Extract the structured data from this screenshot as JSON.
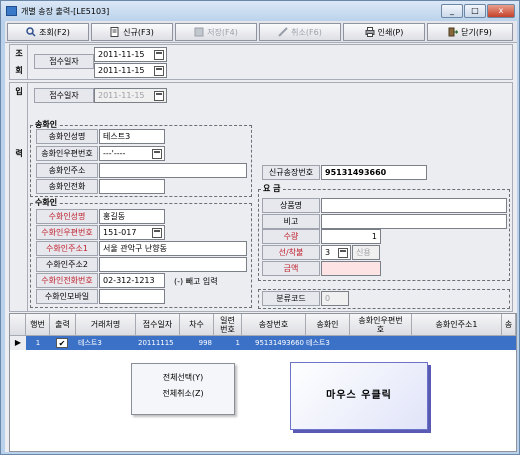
{
  "window": {
    "title": "개별 송장 출력-[LE5103]",
    "min": "_",
    "max": "□",
    "close": "x"
  },
  "toolbar": {
    "query": "조회(F2)",
    "new": "신규(F3)",
    "save": "저장(F4)",
    "delete": "취소(F6)",
    "print": "인쇄(P)",
    "close": "닫기(F9)"
  },
  "query_panel": {
    "section_label_1": "조",
    "section_label_2": "회",
    "date_label": "접수일자",
    "date_from": "2011-11-15",
    "date_to": "2011-11-15"
  },
  "input_panel": {
    "section_label_1": "입",
    "section_label_2": "력",
    "date_label": "접수일자",
    "date_value": "2011-11-15",
    "sender": {
      "title": "송화인",
      "name_label": "송화인성명",
      "name_value": "테스트3",
      "zip_label": "송화인우편번호",
      "zip_value": "---'----",
      "address_label": "송화인주소",
      "phone_label": "송화인전화"
    },
    "receiver": {
      "title": "수화인",
      "name_label": "수화인성명",
      "name_value": "홍길동",
      "zip_label": "수화인우편번호",
      "zip_value": "151-017",
      "address1_label": "수화인주소1",
      "address1_value": "서울 관악구 난향동",
      "address2_label": "수화인주소2",
      "phone_label": "수화인전화번호",
      "phone_value": "02-312-1213",
      "phone_hint": "(-) 빼고 입력",
      "mobile_label": "수화인모바일"
    },
    "invoice_label": "신규송장번호",
    "invoice_value": "95131493660",
    "fee": {
      "title": "요  금",
      "product_label": "상품명",
      "memo_label": "비고",
      "qty_label": "수량",
      "qty_value": "1",
      "prepaid_label": "선/착불",
      "prepaid_value": "3",
      "prepaid_text": "신용",
      "amount_label": "금액"
    },
    "class_code_label": "분류코드",
    "class_code_value": "0"
  },
  "grid": {
    "columns": [
      "행번",
      "출력",
      "거래처명",
      "접수일자",
      "차수",
      "일련\n번호",
      "송장번호",
      "송화인",
      "송화인우편번\n호",
      "송화인주소1",
      "송"
    ],
    "row": {
      "no": "1",
      "printed": "✔",
      "customer": "테스트3",
      "date": "20111115",
      "batch": "998",
      "serial": "1",
      "invoice": "95131493660",
      "sender": "테스트3"
    }
  },
  "context_menu": {
    "select_all": "전체선택(Y)",
    "cancel_all": "전체취소(Z)"
  },
  "callout": "마우스 우클릭"
}
